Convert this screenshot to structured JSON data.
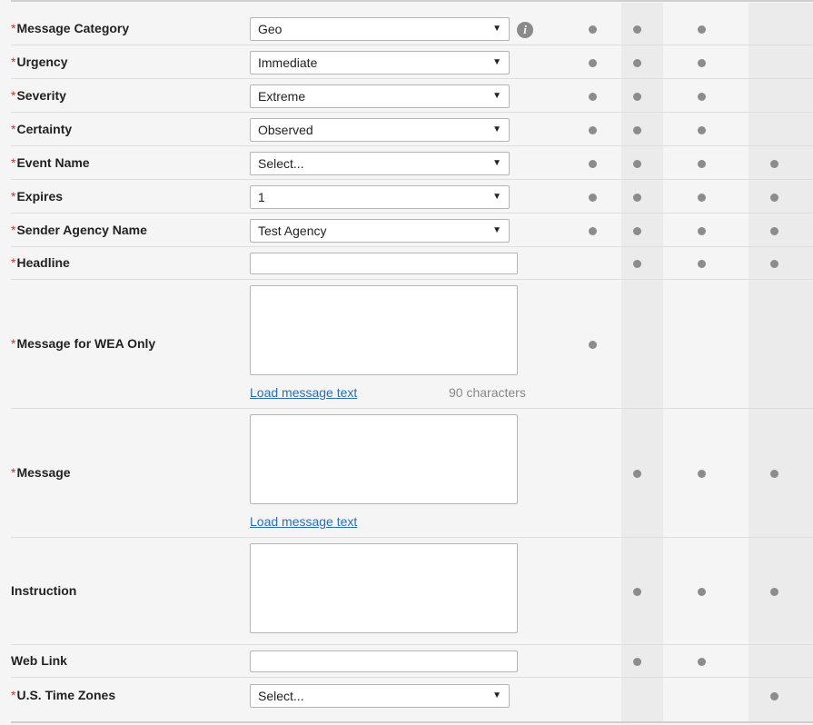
{
  "fields": [
    {
      "key": "message-category",
      "required": true,
      "label": "Message Category",
      "type": "select",
      "value": "Geo",
      "info": true,
      "dots": [
        1,
        1,
        1,
        0
      ]
    },
    {
      "key": "urgency",
      "required": true,
      "label": "Urgency",
      "type": "select",
      "value": "Immediate",
      "dots": [
        1,
        1,
        1,
        0
      ]
    },
    {
      "key": "severity",
      "required": true,
      "label": "Severity",
      "type": "select",
      "value": "Extreme",
      "dots": [
        1,
        1,
        1,
        0
      ]
    },
    {
      "key": "certainty",
      "required": true,
      "label": "Certainty",
      "type": "select",
      "value": "Observed",
      "dots": [
        1,
        1,
        1,
        0
      ]
    },
    {
      "key": "event-name",
      "required": true,
      "label": "Event Name",
      "type": "select",
      "value": "Select...",
      "dots": [
        1,
        1,
        1,
        1
      ]
    },
    {
      "key": "expires",
      "required": true,
      "label": "Expires",
      "type": "select",
      "value": "1",
      "dots": [
        1,
        1,
        1,
        1
      ]
    },
    {
      "key": "sender-agency-name",
      "required": true,
      "label": "Sender Agency Name",
      "type": "select",
      "value": "Test Agency",
      "dots": [
        1,
        1,
        1,
        1
      ]
    },
    {
      "key": "headline",
      "required": true,
      "label": "Headline",
      "type": "input",
      "value": "",
      "dots": [
        0,
        1,
        1,
        1
      ]
    },
    {
      "key": "message-for-wea-only",
      "required": true,
      "label": "Message for WEA Only",
      "type": "textarea",
      "value": "",
      "link": "Load message text",
      "counter": "90 characters",
      "dots": [
        1,
        0,
        0,
        0
      ]
    },
    {
      "key": "message",
      "required": true,
      "label": "Message",
      "type": "textarea",
      "value": "",
      "link": "Load message text",
      "dots": [
        0,
        1,
        1,
        1
      ]
    },
    {
      "key": "instruction",
      "required": false,
      "label": "Instruction",
      "type": "textarea",
      "value": "",
      "dots": [
        0,
        1,
        1,
        1
      ]
    },
    {
      "key": "web-link",
      "required": false,
      "label": "Web Link",
      "type": "input",
      "value": "",
      "dots": [
        0,
        1,
        1,
        0
      ]
    },
    {
      "key": "us-time-zones",
      "required": true,
      "label": "U.S. Time Zones",
      "type": "select",
      "value": "Select...",
      "dots": [
        0,
        0,
        0,
        1
      ]
    }
  ],
  "required_marker": "*",
  "info_icon": "i",
  "select_arrow": "▼"
}
